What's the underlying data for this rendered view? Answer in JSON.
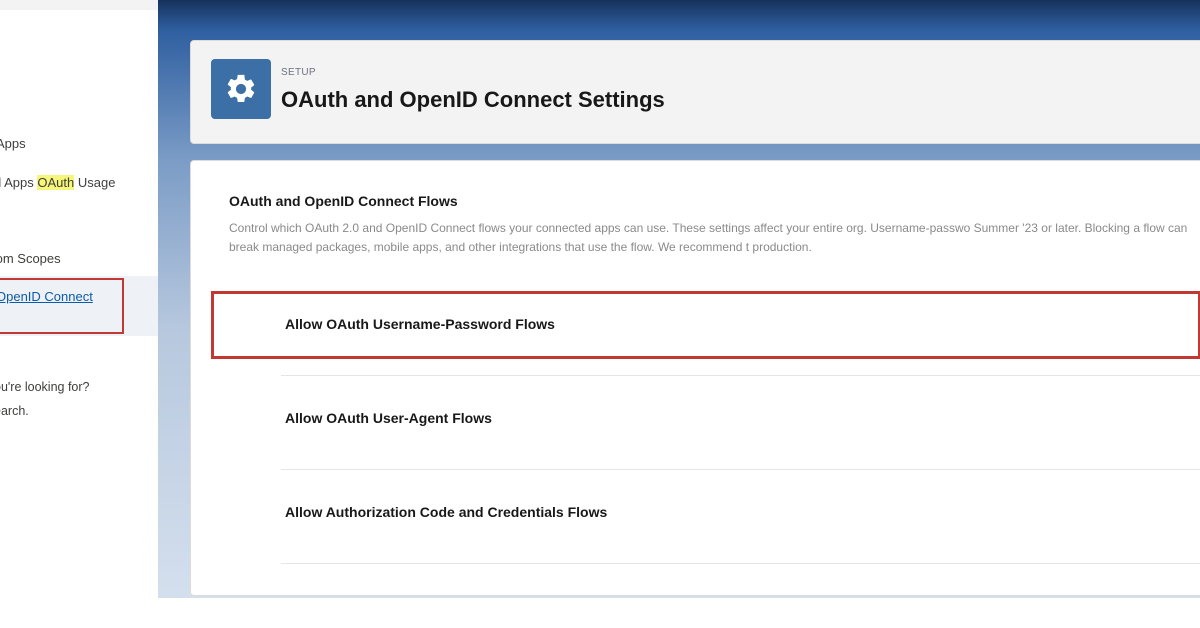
{
  "sidebar": {
    "items": [
      {
        "label": "Apps"
      },
      {
        "label_prefix": "d Apps ",
        "label_highlight": "OAuth",
        "label_suffix": " Usage"
      },
      {
        "label": "tom Scopes"
      }
    ],
    "active_item": {
      "label": "OpenID Connect"
    },
    "help_line1": "ou're looking for?",
    "help_line2": "earch."
  },
  "header": {
    "eyebrow": "SETUP",
    "title": "OAuth and OpenID Connect Settings",
    "icon": "gear-icon"
  },
  "section": {
    "title": "OAuth and OpenID Connect Flows",
    "description": "Control which OAuth 2.0 and OpenID Connect flows your connected apps can use. These settings affect your entire org. Username-passwo Summer '23 or later. Blocking a flow can break managed packages, mobile apps, and other integrations that use the flow. We recommend t production."
  },
  "flows": [
    {
      "label": "Allow OAuth Username-Password Flows",
      "highlighted": true
    },
    {
      "label": "Allow OAuth User-Agent Flows",
      "highlighted": false
    },
    {
      "label": "Allow Authorization Code and Credentials Flows",
      "highlighted": false
    }
  ],
  "colors": {
    "highlight_border": "#c23934",
    "icon_tile": "#3b6fa6",
    "search_highlight": "#f6f67a",
    "link": "#0b5cab"
  }
}
